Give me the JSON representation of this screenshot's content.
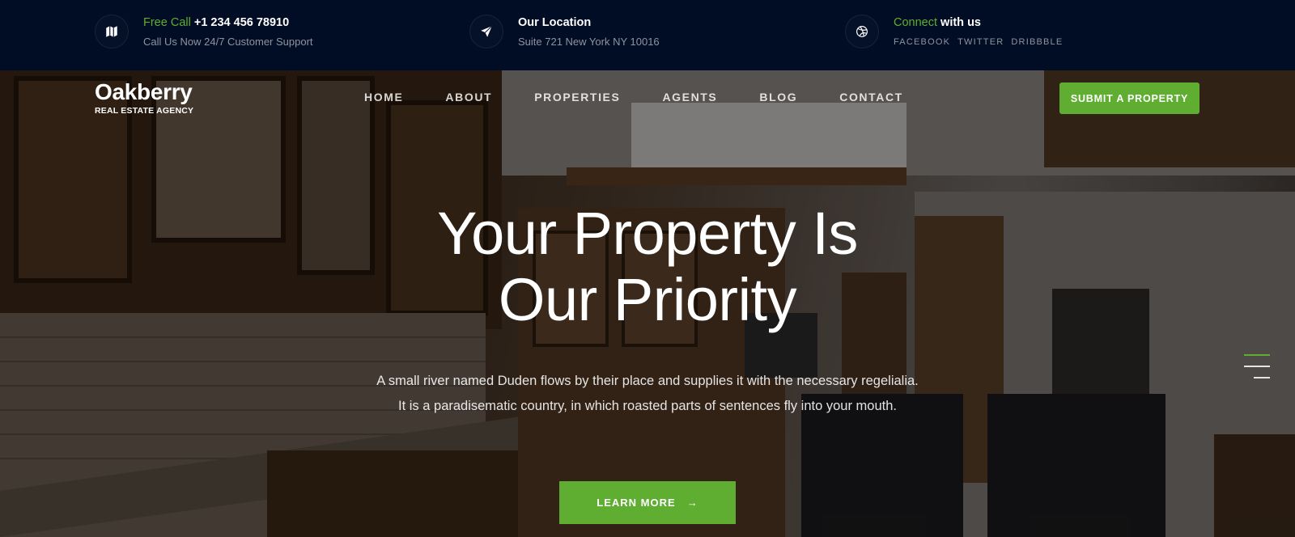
{
  "topbar": {
    "call": {
      "accent": "Free Call",
      "number": "+1 234 456 78910",
      "sub": "Call Us Now 24/7 Customer Support"
    },
    "location": {
      "title": "Our Location",
      "sub": "Suite 721 New York NY 10016"
    },
    "connect": {
      "accent": "Connect",
      "rest": " with us",
      "links": [
        "FACEBOOK",
        "TWITTER",
        "DRIBBBLE"
      ]
    }
  },
  "brand": {
    "name": "Oakberry",
    "tagline": "REAL ESTATE AGENCY"
  },
  "nav": {
    "items": [
      "HOME",
      "ABOUT",
      "PROPERTIES",
      "AGENTS",
      "BLOG",
      "CONTACT"
    ]
  },
  "cta": {
    "submit": "SUBMIT A PROPERTY",
    "learn_more": "LEARN MORE",
    "learn_more_arrow": "→"
  },
  "hero": {
    "title_line1": "Your Property Is",
    "title_line2": "Our Priority",
    "text": "A small river named Duden flows by their place and supplies it with the necessary regelialia. It is a paradisematic country, in which roasted parts of sentences fly into your mouth."
  },
  "icons": {
    "call": "map-icon",
    "location": "paper-plane-icon",
    "connect": "dribbble-icon"
  },
  "colors": {
    "accent": "#5fae32",
    "topbar_bg": "#000d24"
  }
}
